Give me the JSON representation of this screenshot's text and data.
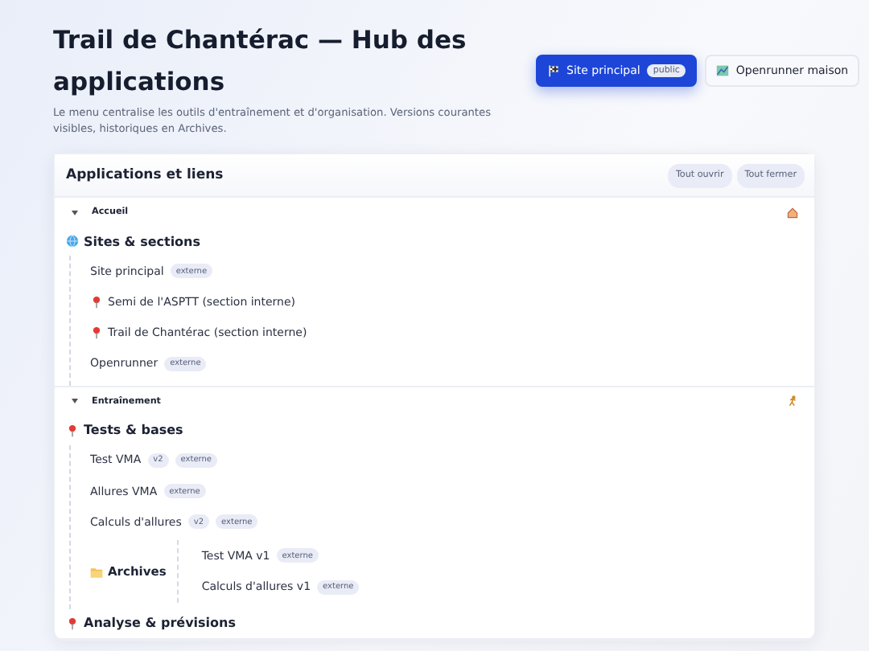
{
  "header": {
    "title": "Trail de Chantérac — Hub des applications",
    "subtitle": "Le menu centralise les outils d'entraînement et d'organisation. Versions courantes visibles, historiques en Archives.",
    "buttons": [
      {
        "label": "Site principal",
        "kind": "primary",
        "badge": "public"
      },
      {
        "label": "Openrunner maison",
        "kind": "secondary"
      }
    ]
  },
  "panel": {
    "title": "Applications et liens",
    "actions": [
      "Tout ouvrir",
      "Tout fermer"
    ],
    "sections": [
      {
        "title": "Accueil",
        "kind": "home",
        "expanded": true,
        "groups": [
          {
            "title": "Sites & sections",
            "kind": "globe",
            "items": [
              {
                "label": "Site principal",
                "kind": "link",
                "badges": [
                  "externe"
                ]
              },
              {
                "label": "Semi de l'ASPTT (section interne)",
                "kind": "pinned"
              },
              {
                "label": "Trail de Chantérac (section interne)",
                "kind": "pinned"
              },
              {
                "label": "Openrunner",
                "kind": "link",
                "badges": [
                  "externe"
                ]
              }
            ]
          }
        ]
      },
      {
        "title": "Entraînement",
        "kind": "training",
        "expanded": true,
        "groups": [
          {
            "title": "Tests & bases",
            "kind": "pin",
            "items": [
              {
                "label": "Test VMA",
                "kind": "link",
                "badges": [
                  "v2",
                  "externe"
                ]
              },
              {
                "label": "Allures VMA",
                "kind": "link",
                "badges": [
                  "externe"
                ]
              },
              {
                "label": "Calculs d'allures",
                "kind": "link",
                "badges": [
                  "v2",
                  "externe"
                ]
              }
            ],
            "archives": {
              "title": "Archives",
              "items": [
                {
                  "label": "Test VMA v1",
                  "kind": "link",
                  "badges": [
                    "externe"
                  ]
                },
                {
                  "label": "Calculs d'allures v1",
                  "kind": "link",
                  "badges": [
                    "externe"
                  ]
                }
              ]
            }
          },
          {
            "title": "Analyse & prévisions",
            "kind": "pin"
          }
        ]
      }
    ]
  }
}
